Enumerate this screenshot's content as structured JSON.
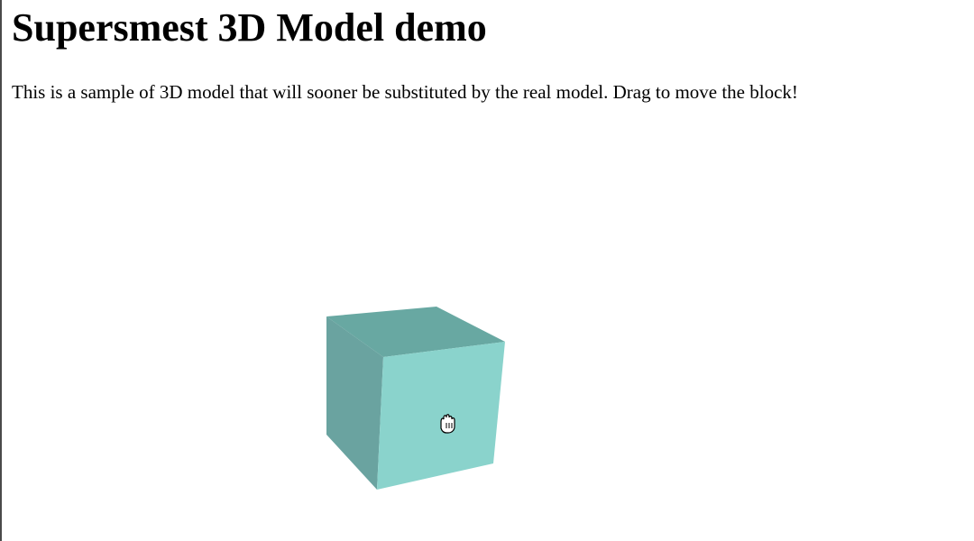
{
  "page": {
    "title": "Supersmest 3D Model demo",
    "description": "This is a sample of 3D model that will sooner be substituted by the real model. Drag to move the block!"
  },
  "model": {
    "colors": {
      "top": "#68a8a2",
      "left": "#6aa3a0",
      "front": "#8ad3cc"
    },
    "cursor_icon": "grab-hand-icon"
  }
}
